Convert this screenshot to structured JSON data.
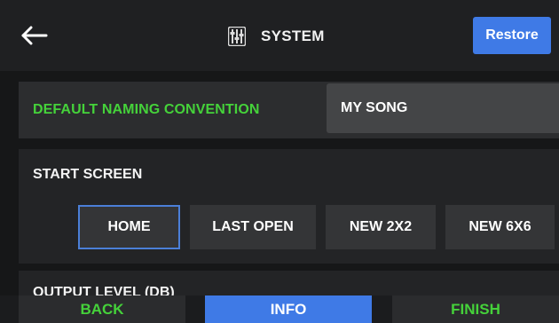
{
  "header": {
    "title": "SYSTEM",
    "restore_label": "Restore"
  },
  "naming": {
    "label": "DEFAULT NAMING CONVENTION",
    "value": "MY SONG"
  },
  "start_screen": {
    "label": "START SCREEN",
    "options": [
      "HOME",
      "LAST OPEN",
      "NEW 2X2",
      "NEW 6X6"
    ],
    "selected": "HOME"
  },
  "output_level": {
    "label": "OUTPUT LEVEL (DB)"
  },
  "bottom": {
    "back_label": "BACK",
    "info_label": "INFO",
    "finish_label": "FINISH"
  },
  "colors": {
    "accent_blue": "#3f7ae6",
    "accent_green": "#45d23a",
    "background": "#161718"
  },
  "icons": {
    "back": "arrow-left-icon",
    "title": "sliders-icon"
  }
}
